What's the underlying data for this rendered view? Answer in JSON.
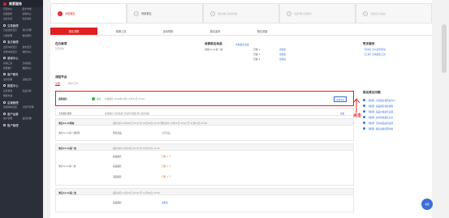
{
  "sidebar": {
    "logo": "卖家服务",
    "groups": [
      {
        "title": "",
        "items": [
          "首页中心",
          "服务市场",
          "店铺装修",
          "营销中心",
          "卖家培训",
          "商家成长"
        ]
      },
      {
        "title": "交易管理",
        "items": [
          "已卖出的宝贝",
          "评价管理",
          "分销管理",
          "物流服务"
        ]
      },
      {
        "title": "宝贝管理",
        "items": [
          "出售中的宝贝",
          "发布宝贝",
          "仓库中的宝贝",
          "体检中心"
        ]
      },
      {
        "title": "营销中心",
        "items": [
          "营销工具",
          "活动报名",
          "我要推广",
          "数据中心"
        ]
      },
      {
        "title": "客户服务",
        "items": [
          "退款管理",
          "违规记录"
        ]
      },
      {
        "title": "数据中心",
        "items": [
          "生意参谋",
          "商品分析",
          "数据作战"
        ]
      },
      {
        "title": "店铺管理",
        "items": [
          "店铺基本设置",
          "子账号管理"
        ]
      },
      {
        "title": "客户运营",
        "items": [
          "客户管理",
          "会员管理"
        ]
      },
      {
        "title": "账户管理",
        "items": []
      }
    ]
  },
  "steps": [
    {
      "num": "1",
      "label": "大促报名",
      "active": true
    },
    {
      "num": "2",
      "label": "商家报名",
      "active": false
    },
    {
      "num": "3",
      "label": "报名审核 活动前准备",
      "active": false
    },
    {
      "num": "4",
      "label": "活动开始 活动期间",
      "active": false
    },
    {
      "num": "5",
      "label": "活动结束 活动后",
      "active": false
    }
  ],
  "tabs": [
    "报名流程",
    "营销工具",
    "活动规则",
    "报名素材",
    "报名进度"
  ],
  "overview": {
    "title": "在办事项",
    "subtitle": "暂无待办",
    "goods_title": "商家报名商品",
    "goods_link": "查看报名进度",
    "goods_rows": [
      {
        "name": "淘宝11.11第一波",
        "status": "已报 1",
        "link": "去报名"
      },
      {
        "name": "",
        "status": "已报 1",
        "link": "去报名"
      },
      {
        "name": "",
        "status": "已报 1",
        "link": "去报名"
      }
    ],
    "more_title": "更多服务",
    "more_links": [
      "【活动】怎么提升招商",
      "【工具】活动报名工具"
    ]
  },
  "flow": {
    "title": "流程节点",
    "filters": [
      "全部",
      "待办工作"
    ],
    "highlight": {
      "name": "商家报名",
      "status": "成功",
      "detail": "有效报名 2022年10月 11月11日 23:59",
      "button": "查看活动"
    },
    "row2": {
      "name": "大家报名类别",
      "detail": "在线报名 后续处理 活动时可报名参与商家报名",
      "link": "去看"
    },
    "groups": [
      {
        "name": "淘宝11.11预热",
        "time": "报名时间 10月20日 00:00 至 10月26日 23:59  预热时间 10月31日 20:00 至 11月03日 23:59",
        "sub": "淘宝11.11第一波预售",
        "sub_col": "预售商品",
        "sub_col2": "全部商品"
      },
      {
        "name": "淘宝11.11第一波",
        "time": "报名时间 10月24日 00:00 至 10月31日 23:59",
        "sub": "淘宝11.11第一波",
        "sub_col": "商品报名",
        "sub_col2": "已报 1",
        "rows": [
          "商品报名",
          "商品报名",
          "选品报名"
        ],
        "vals": [
          "已报 1 个",
          "已报 1 个",
          "已报 1 个"
        ]
      },
      {
        "name": "淘宝11.11第二波",
        "time": "报名时间 11月01日 00:00 至 11月03日 23:59",
        "sub": "",
        "sub_col": "商品报名",
        "sub_col2": "去报名"
      }
    ]
  },
  "faq": {
    "title": "报名常见问题",
    "items": [
      "【规则】大促报名规则是什么",
      "【规则】商品报名审核规则",
      "【规则】商品价格如何设置",
      "【规则】如何修改报名信息",
      "【规则】活动商品如何发货",
      "【规则】报名失败原因查看"
    ]
  },
  "annotation": {
    "click_label": "点击"
  },
  "float_button": "客服",
  "colors": {
    "accent": "#e02020",
    "link": "#3b6fd8",
    "success": "#31b34a"
  }
}
